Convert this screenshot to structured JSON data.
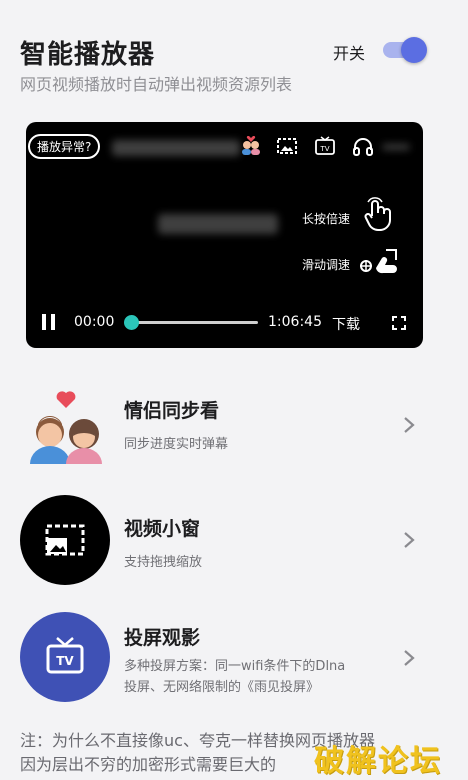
{
  "header": {
    "title": "智能播放器",
    "subtitle": "网页视频播放时自动弹出视频资源列表",
    "switch_label": "开关",
    "switch_on": true,
    "accent": "#5b6ee2"
  },
  "player": {
    "badge": "播放异常?",
    "hint_speed": "长按倍速",
    "hint_slide": "滑动调速",
    "time_current": "00:00",
    "time_total": "1:06:45",
    "download": "下载",
    "progress": 0,
    "seek_color": "#2bc5b9"
  },
  "features": [
    {
      "title": "情侣同步看",
      "desc": "同步进度实时弹幕",
      "icon": "couple-icon"
    },
    {
      "title": "视频小窗",
      "desc": "支持拖拽缩放",
      "icon": "picture-in-picture-icon",
      "color": "#000000"
    },
    {
      "title": "投屏观影",
      "desc_line1": "多种投屏方案：同一wifi条件下的Dlna",
      "desc_line2": "投屏、无网络限制的《雨见投屏》",
      "icon": "tv-icon",
      "color": "#3f51b5"
    }
  ],
  "note": {
    "line1": "注：为什么不直接像uc、夸克一样替换网页播放器",
    "line2": "因为层出不穷的加密形式需要巨大的"
  },
  "watermark": "破解论坛"
}
